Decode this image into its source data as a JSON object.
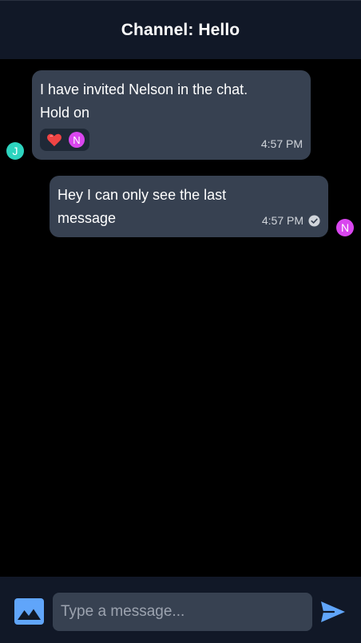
{
  "header": {
    "title": "Channel: Hello"
  },
  "messages": [
    {
      "text": "I have invited Nelson in the chat. Hold on",
      "time": "4:57 PM",
      "author_initial": "J",
      "avatar_color": "#2dd4bf",
      "reactions": [
        {
          "icon": "heart-icon",
          "color": "#ef4444"
        },
        {
          "initial": "N",
          "color": "#d946ef"
        }
      ]
    },
    {
      "text": "Hey I can only see the last message",
      "time": "4:57 PM",
      "author_initial": "N",
      "avatar_color": "#d946ef",
      "status_icon": "check-circle-icon"
    }
  ],
  "composer": {
    "placeholder": "Type a message...",
    "value": "",
    "image_icon": "image-icon",
    "send_icon": "send-icon",
    "accent": "#60a5fa"
  },
  "colors": {
    "header_bg": "#111827",
    "bubble_bg": "#374151",
    "background": "#000000"
  }
}
